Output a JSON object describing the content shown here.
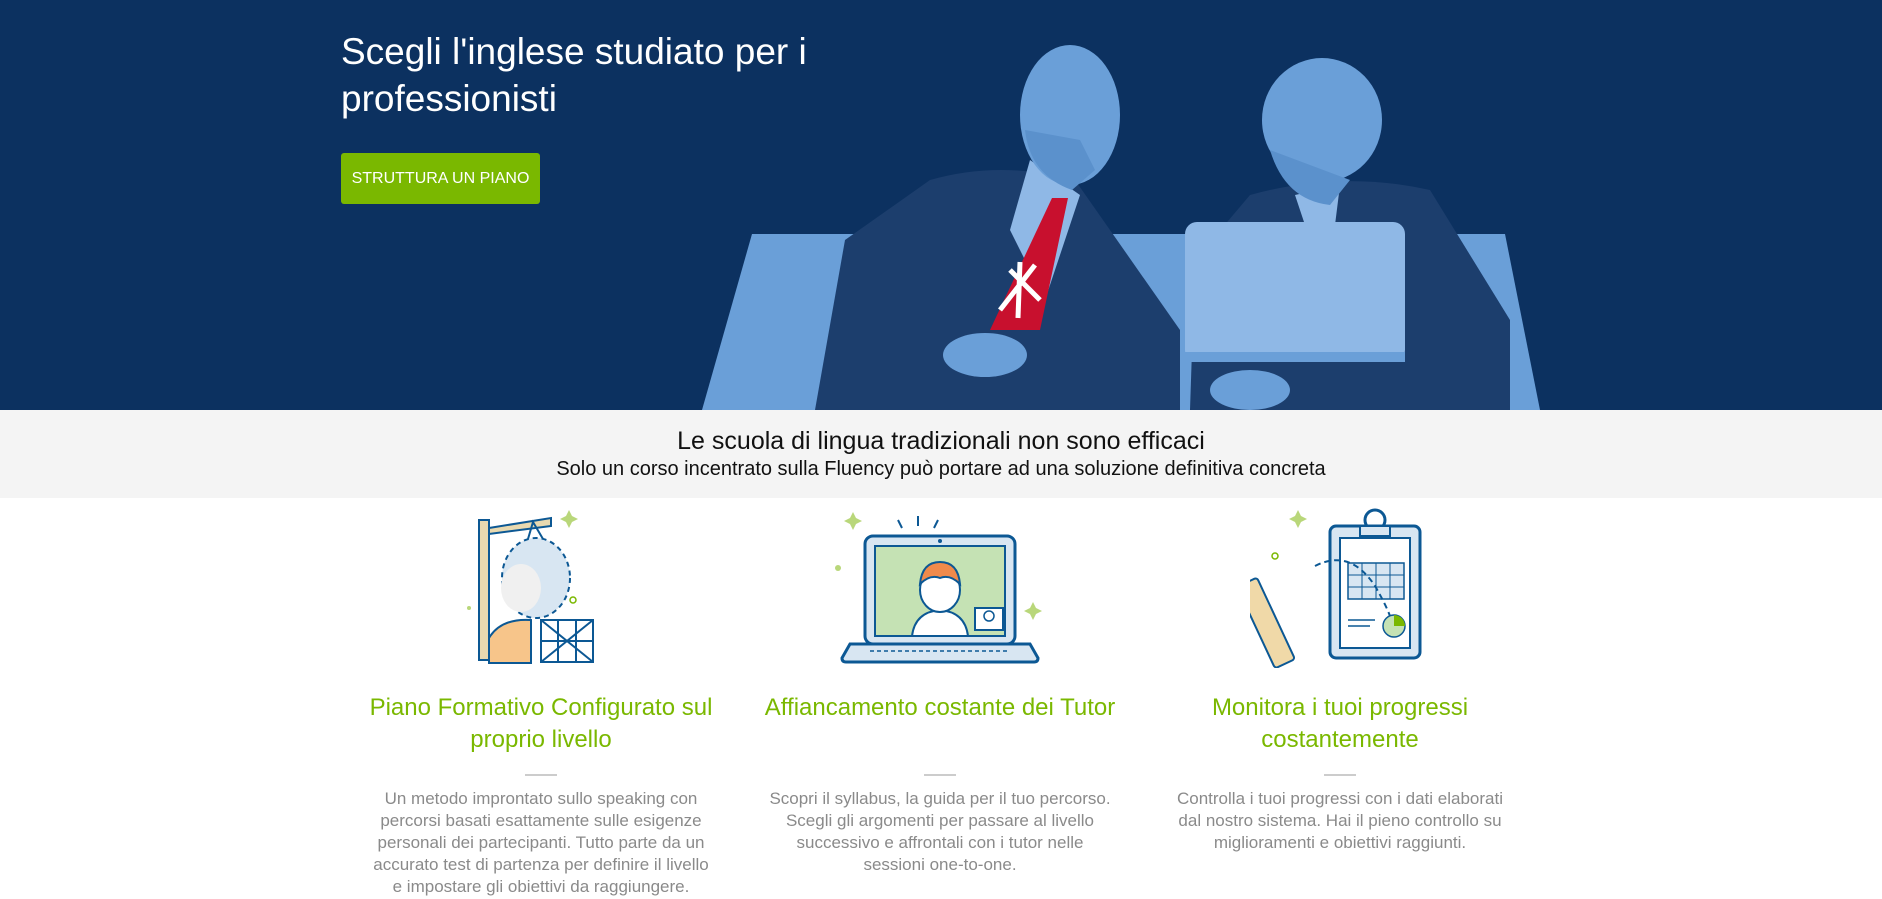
{
  "hero": {
    "title": "Scegli l'inglese studiato per i professionisti",
    "cta_label": "STRUTTURA UN PIANO",
    "background_color": "#0c3160",
    "cta_color": "#7ab800"
  },
  "intro": {
    "title": "Le scuola di lingua tradizionali non sono efficaci",
    "subtitle": "Solo un corso incentrato sulla Fluency può portare ad una soluzione definitiva concreta"
  },
  "features": [
    {
      "icon": "construction-crane-icon",
      "title": "Piano Formativo Configurato sul proprio livello",
      "text": "Un metodo improntato sullo speaking con percorsi basati esattamente sulle esigenze personali dei partecipanti. Tutto parte da un accurato test di partenza per definire il livello e impostare gli obiettivi da raggiungere."
    },
    {
      "icon": "laptop-video-call-icon",
      "title": "Affiancamento costante dei Tutor",
      "text": "Scopri il syllabus, la guida per il tuo percorso. Scegli gli argomenti per passare al livello successivo e affrontali con i tutor nelle sessioni one-to-one."
    },
    {
      "icon": "clipboard-ruler-icon",
      "title": "Monitora i tuoi progressi costantemente",
      "text": "Controlla i tuoi progressi con i dati elaborati dal nostro sistema. Hai il pieno controllo su miglioramenti e obiettivi raggiunti."
    }
  ],
  "accent_green": "#7ab800",
  "text_gray": "#8a8a8a"
}
